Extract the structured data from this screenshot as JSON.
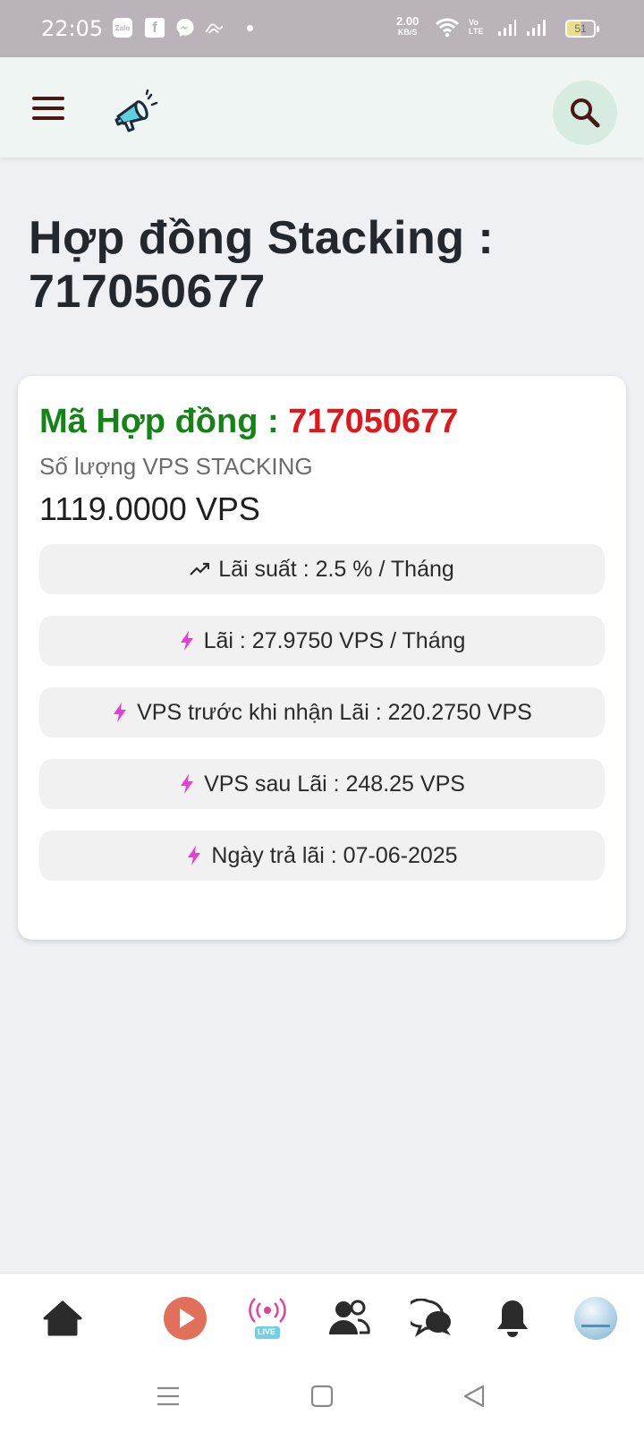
{
  "status_bar": {
    "time": "22:05",
    "zalo_label": "Zalo",
    "fb_label": "f",
    "net_speed": "2.00",
    "net_speed_unit": "KB/S",
    "volte_top": "Vo",
    "volte_bottom": "LTE",
    "battery": "51"
  },
  "header": {
    "menu_icon": "hamburger-menu-icon",
    "logo_icon": "megaphone-icon",
    "search_icon": "search-icon"
  },
  "page": {
    "title": "Hợp đồng Stacking : 717050677"
  },
  "card": {
    "contract_label": "Mã Hợp đồng : ",
    "contract_id": "717050677",
    "qty_label": "Số lượng VPS STACKING",
    "qty_value": "1119.0000 VPS",
    "rows": [
      {
        "icon": "trending-up-icon",
        "text": "Lãi suất : 2.5 % / Tháng"
      },
      {
        "icon": "lightning-icon",
        "text": "Lãi : 27.9750 VPS / Tháng"
      },
      {
        "icon": "lightning-icon",
        "text": "VPS trước khi nhận Lãi : 220.2750 VPS"
      },
      {
        "icon": "lightning-icon",
        "text": "VPS sau Lãi : 248.25 VPS"
      },
      {
        "icon": "lightning-icon",
        "text": "Ngày trả lãi : 07-06-2025"
      }
    ]
  },
  "bottom_nav": {
    "live_label": "LIVE",
    "items": [
      "home-icon",
      "play-icon",
      "live-icon",
      "friends-icon",
      "chat-icon",
      "bell-icon",
      "avatar"
    ]
  },
  "colors": {
    "green": "#148417",
    "red": "#e0171b",
    "lightning": "#e83fd3",
    "play": "#e0705a"
  }
}
